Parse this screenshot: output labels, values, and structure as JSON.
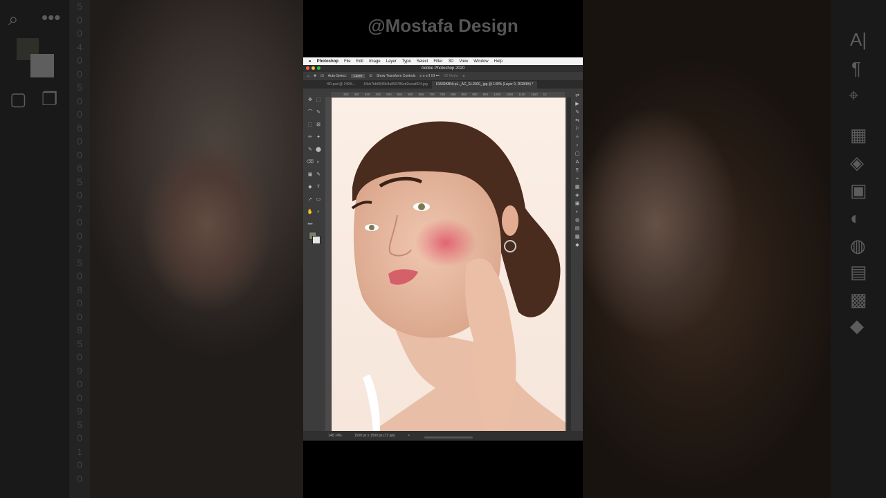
{
  "watermark": "@Mostafa Design",
  "window_title": "Adobe Photoshop 2020",
  "menu": [
    "Photoshop",
    "File",
    "Edit",
    "Image",
    "Layer",
    "Type",
    "Select",
    "Filter",
    "3D",
    "View",
    "Window",
    "Help"
  ],
  "options": {
    "auto_select_label": "Auto-Select:",
    "auto_select_value": "Layer",
    "transform_label": "Show Transform Controls",
    "mode_3d": "3D Mode:"
  },
  "tabs": [
    {
      "label": "HD.psd @ 149%...",
      "active": false
    },
    {
      "label": "64cb7bb6946fc8a890786eb2eead924.jpg",
      "active": false
    },
    {
      "label": "61539KBN+pL._AC_SL1500_.jpg @ 149% (Layer 0, RGB/8#) *",
      "active": true
    }
  ],
  "ruler_ticks": [
    "300",
    "350",
    "400",
    "450",
    "500",
    "550",
    "600",
    "650",
    "700",
    "750",
    "800",
    "850",
    "900",
    "950",
    "1000",
    "1050",
    "1100",
    "1150",
    "12"
  ],
  "status": {
    "zoom": "148.14%",
    "doc_size": "1500 px x 1500 px (72 ppi)",
    "arrow": ">"
  },
  "side_left_ruler": [
    "5",
    "0",
    "0",
    "4",
    "0",
    "0",
    "5",
    "0",
    "0",
    "6",
    "0",
    "0",
    "6",
    "5",
    "0",
    "7",
    "0",
    "0",
    "7",
    "5",
    "0",
    "8",
    "0",
    "0",
    "8",
    "5",
    "0",
    "9",
    "0",
    "0",
    "9",
    "5",
    "0",
    "1",
    "0",
    "0"
  ],
  "colors": {
    "accent": "#2f80ed",
    "window_bg": "#3c3c3c",
    "foreground_swatch": "#7d7d6a",
    "background_swatch": "#e6e6e6"
  }
}
